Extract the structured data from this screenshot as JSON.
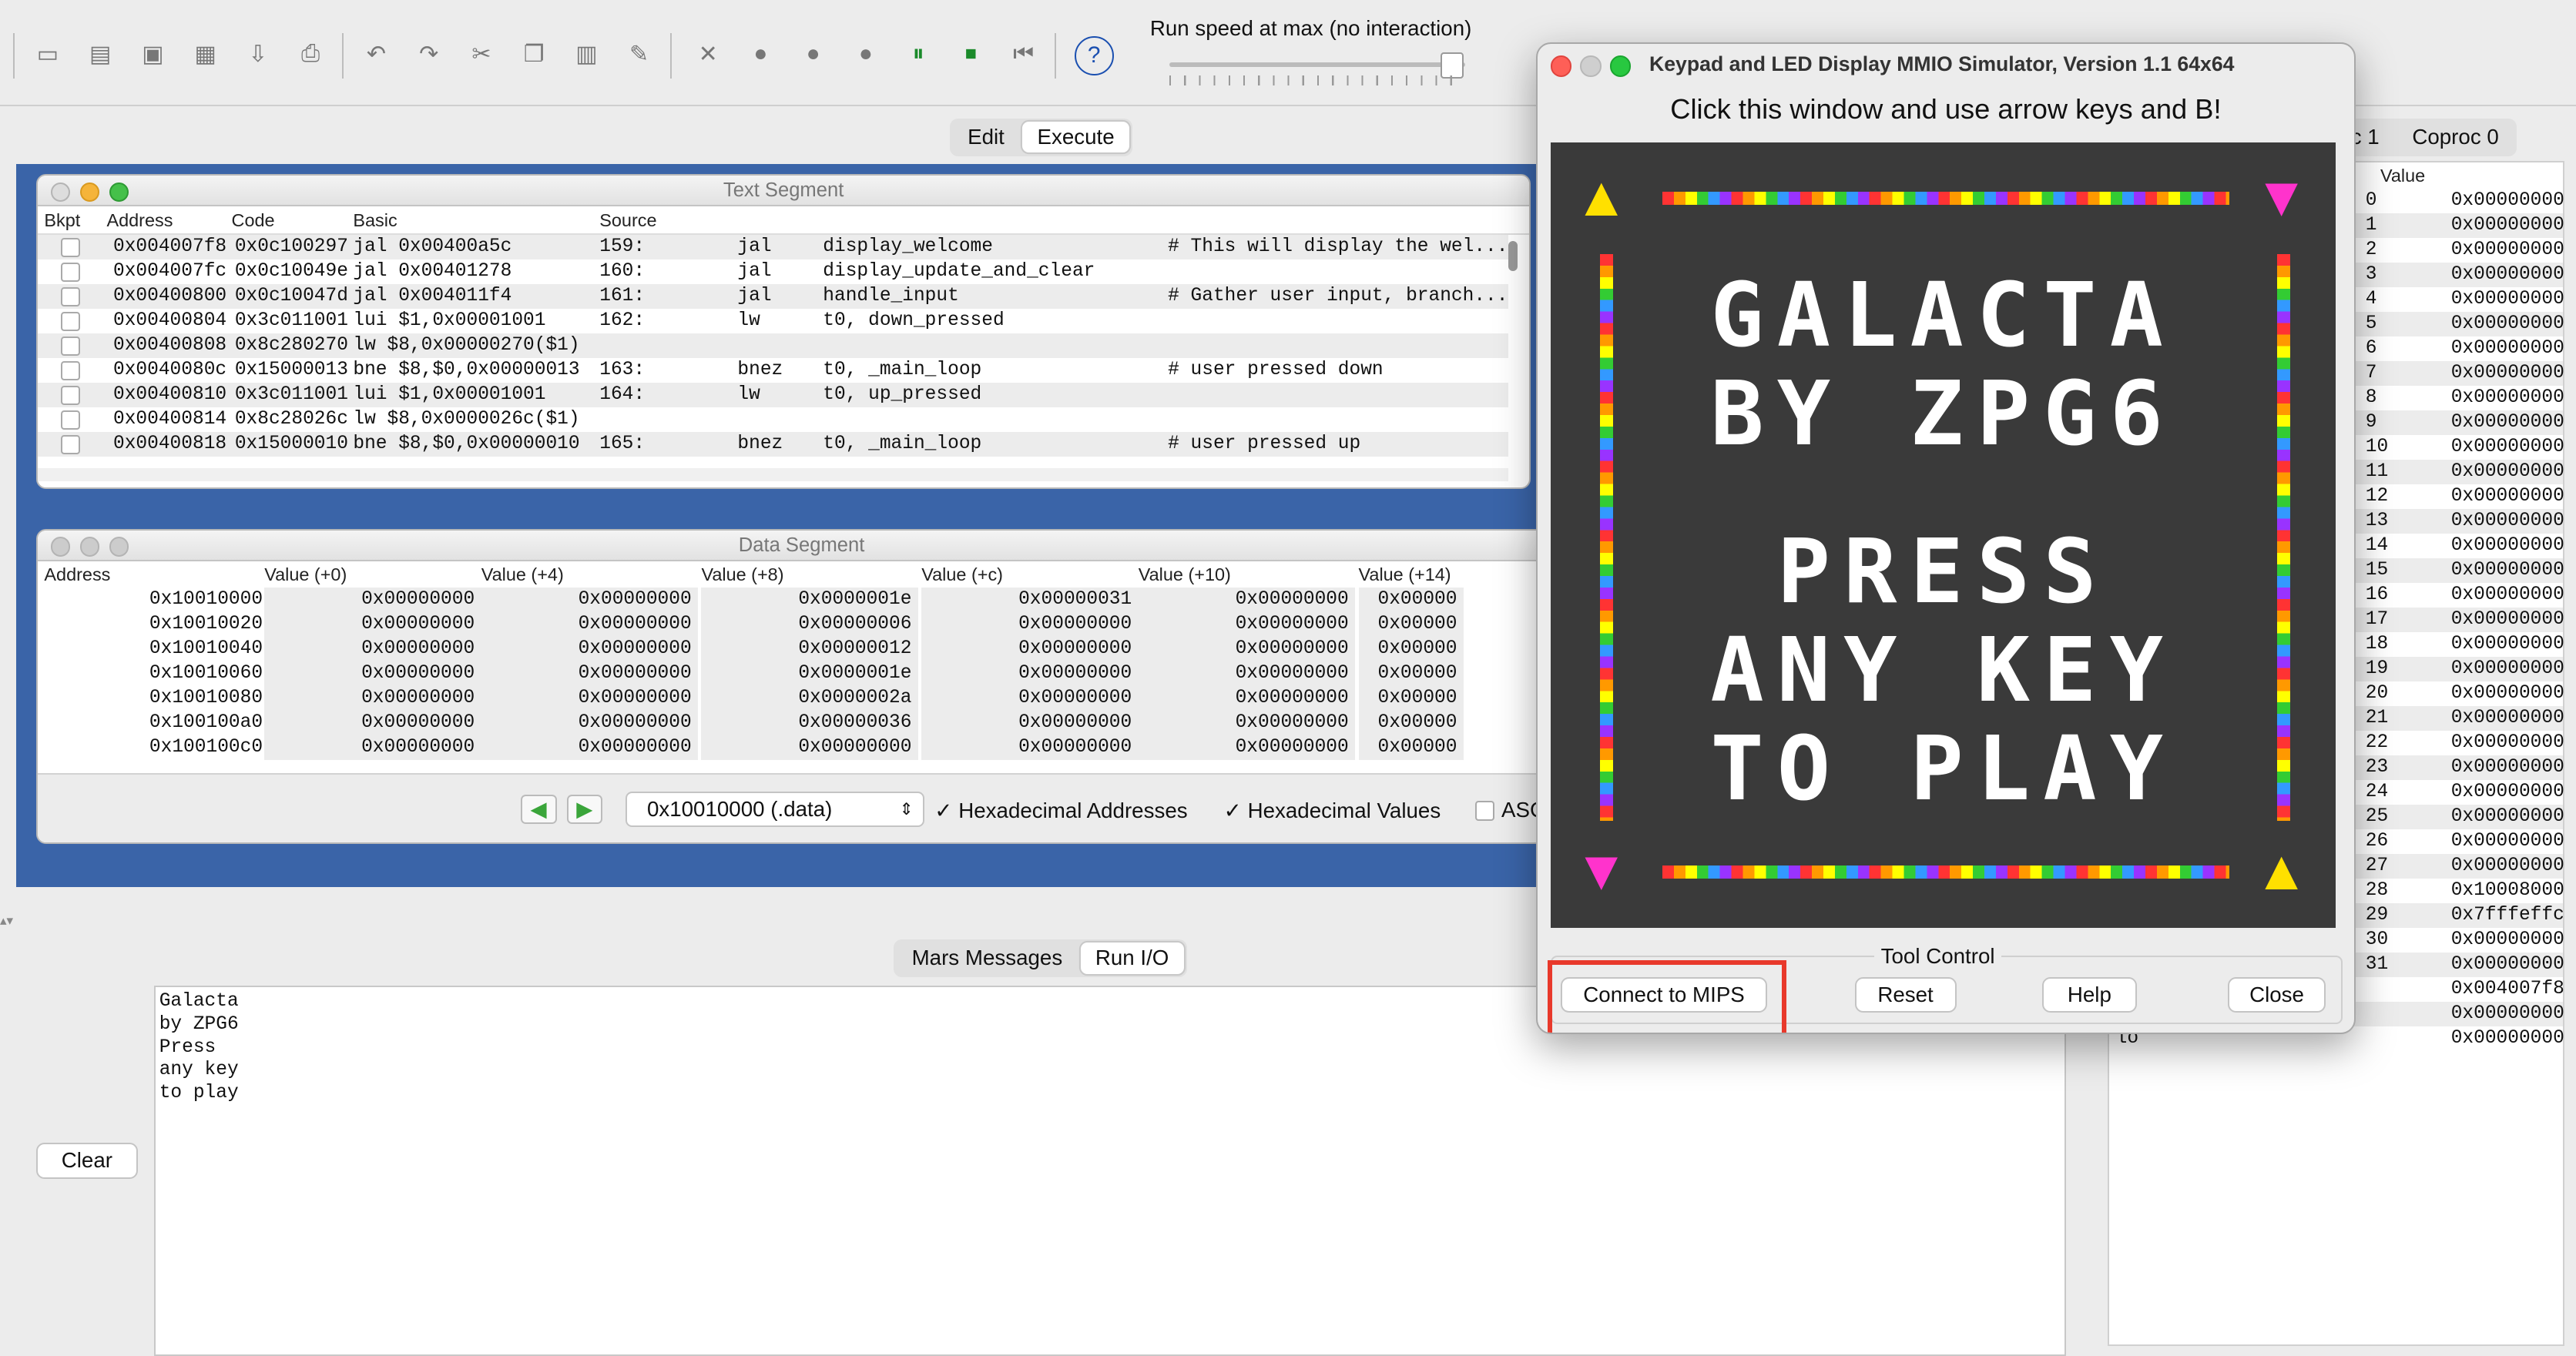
{
  "toolbar": {
    "speed_label": "Run speed at max (no interaction)",
    "speed_value": 0.95
  },
  "main_tabs": [
    "Edit",
    "Execute"
  ],
  "text_segment": {
    "title": "Text Segment",
    "headers": [
      "Bkpt",
      "Address",
      "Code",
      "Basic",
      "Source"
    ],
    "rows": [
      {
        "addr": "0x004007f8",
        "code": "0x0c100297",
        "basic": "jal 0x00400a5c",
        "line": "159:",
        "op": "jal",
        "args": "display_welcome",
        "comment": "# This will display the wel..."
      },
      {
        "addr": "0x004007fc",
        "code": "0x0c10049e",
        "basic": "jal 0x00401278",
        "line": "160:",
        "op": "jal",
        "args": "display_update_and_clear",
        "comment": ""
      },
      {
        "addr": "0x00400800",
        "code": "0x0c10047d",
        "basic": "jal 0x004011f4",
        "line": "161:",
        "op": "jal",
        "args": "handle_input",
        "comment": "# Gather user input, branch..."
      },
      {
        "addr": "0x00400804",
        "code": "0x3c011001",
        "basic": "lui $1,0x00001001",
        "line": "162:",
        "op": "lw",
        "args": "t0, down_pressed",
        "comment": ""
      },
      {
        "addr": "0x00400808",
        "code": "0x8c280270",
        "basic": "lw $8,0x00000270($1)",
        "line": "",
        "op": "",
        "args": "",
        "comment": ""
      },
      {
        "addr": "0x0040080c",
        "code": "0x15000013",
        "basic": "bne $8,$0,0x00000013",
        "line": "163:",
        "op": "bnez",
        "args": "t0, _main_loop",
        "comment": "# user pressed down"
      },
      {
        "addr": "0x00400810",
        "code": "0x3c011001",
        "basic": "lui $1,0x00001001",
        "line": "164:",
        "op": "lw",
        "args": "t0, up_pressed",
        "comment": ""
      },
      {
        "addr": "0x00400814",
        "code": "0x8c28026c",
        "basic": "lw $8,0x0000026c($1)",
        "line": "",
        "op": "",
        "args": "",
        "comment": ""
      },
      {
        "addr": "0x00400818",
        "code": "0x15000010",
        "basic": "bne $8,$0,0x00000010",
        "line": "165:",
        "op": "bnez",
        "args": "t0, _main_loop",
        "comment": "# user pressed up"
      }
    ]
  },
  "data_segment": {
    "title": "Data Segment",
    "headers": [
      "Address",
      "Value (+0)",
      "Value (+4)",
      "Value (+8)",
      "Value (+c)",
      "Value (+10)",
      "Value (+14)"
    ],
    "rows": [
      [
        "0x10010000",
        "0x00000000",
        "0x00000000",
        "0x0000001e",
        "0x00000031",
        "0x00000000",
        "0x00000"
      ],
      [
        "0x10010020",
        "0x00000000",
        "0x00000000",
        "0x00000006",
        "0x00000000",
        "0x00000000",
        "0x00000"
      ],
      [
        "0x10010040",
        "0x00000000",
        "0x00000000",
        "0x00000012",
        "0x00000000",
        "0x00000000",
        "0x00000"
      ],
      [
        "0x10010060",
        "0x00000000",
        "0x00000000",
        "0x0000001e",
        "0x00000000",
        "0x00000000",
        "0x00000"
      ],
      [
        "0x10010080",
        "0x00000000",
        "0x00000000",
        "0x0000002a",
        "0x00000000",
        "0x00000000",
        "0x00000"
      ],
      [
        "0x100100a0",
        "0x00000000",
        "0x00000000",
        "0x00000036",
        "0x00000000",
        "0x00000000",
        "0x00000"
      ],
      [
        "0x100100c0",
        "0x00000000",
        "0x00000000",
        "0x00000000",
        "0x00000000",
        "0x00000000",
        "0x00000"
      ]
    ],
    "segment_select": "0x10010000 (.data)",
    "hex_addresses": "Hexadecimal Addresses",
    "hex_values": "Hexadecimal Values",
    "ascii": "ASC"
  },
  "bottom_tabs": [
    "Mars Messages",
    "Run I/O"
  ],
  "console": {
    "clear": "Clear",
    "lines": [
      "Galacta",
      "by ZPG6",
      "Press",
      "any key",
      "to play"
    ]
  },
  "registers": {
    "tabs": [
      "c 1",
      "Coproc 0"
    ],
    "value_header": "Value",
    "rows": [
      [
        "0",
        "0x00000000"
      ],
      [
        "1",
        "0x00000000"
      ],
      [
        "2",
        "0x00000000"
      ],
      [
        "3",
        "0x00000000"
      ],
      [
        "4",
        "0x00000000"
      ],
      [
        "5",
        "0x00000000"
      ],
      [
        "6",
        "0x00000000"
      ],
      [
        "7",
        "0x00000000"
      ],
      [
        "8",
        "0x00000000"
      ],
      [
        "9",
        "0x00000000"
      ],
      [
        "10",
        "0x00000000"
      ],
      [
        "11",
        "0x00000000"
      ],
      [
        "12",
        "0x00000000"
      ],
      [
        "13",
        "0x00000000"
      ],
      [
        "14",
        "0x00000000"
      ],
      [
        "15",
        "0x00000000"
      ],
      [
        "16",
        "0x00000000"
      ],
      [
        "17",
        "0x00000000"
      ],
      [
        "18",
        "0x00000000"
      ],
      [
        "19",
        "0x00000000"
      ],
      [
        "20",
        "0x00000000"
      ],
      [
        "21",
        "0x00000000"
      ],
      [
        "22",
        "0x00000000"
      ],
      [
        "23",
        "0x00000000"
      ],
      [
        "24",
        "0x00000000"
      ],
      [
        "25",
        "0x00000000"
      ],
      [
        "26",
        "0x00000000"
      ],
      [
        "27",
        "0x00000000"
      ],
      [
        "28",
        "0x10008000"
      ],
      [
        "29",
        "0x7fffeffc"
      ],
      [
        "30",
        "0x00000000"
      ],
      [
        "31",
        "0x00000000"
      ],
      [
        "",
        "0x004007f8"
      ],
      [
        "",
        "0x00000000"
      ],
      [
        "lo",
        "0x00000000"
      ]
    ]
  },
  "simulator": {
    "title": "Keypad and LED Display MMIO Simulator, Version 1.1 64x64",
    "instruction": "Click this window and use arrow keys and B!",
    "screen_lines": [
      "GALACTA",
      "BY ZPG6",
      "",
      "PRESS",
      "ANY KEY",
      "TO PLAY"
    ],
    "tool_control": "Tool Control",
    "buttons": {
      "connect": "Connect to MIPS",
      "reset": "Reset",
      "help": "Help",
      "close": "Close"
    },
    "highlight_color": "#e8392b"
  }
}
